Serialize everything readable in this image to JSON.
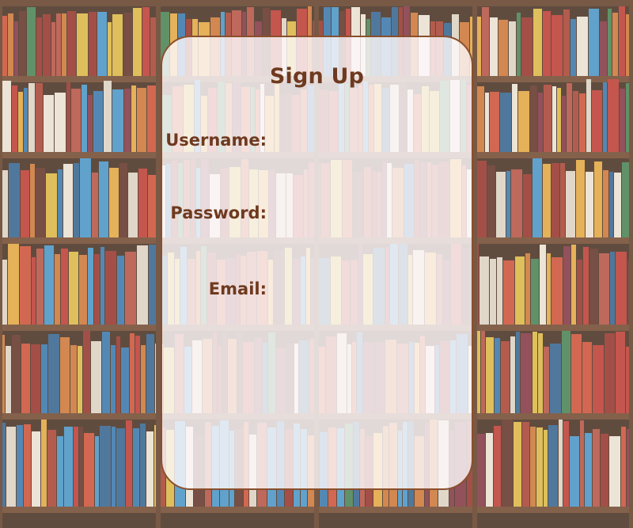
{
  "form": {
    "title": "Sign Up",
    "fields": [
      {
        "label": "Username:",
        "value": ""
      },
      {
        "label": "Password:",
        "value": ""
      },
      {
        "label": "Email:",
        "value": ""
      }
    ]
  },
  "colors": {
    "text": "#6e3a1f",
    "card_border": "#8a4f2c",
    "card_fill": "#fcf9fa"
  }
}
